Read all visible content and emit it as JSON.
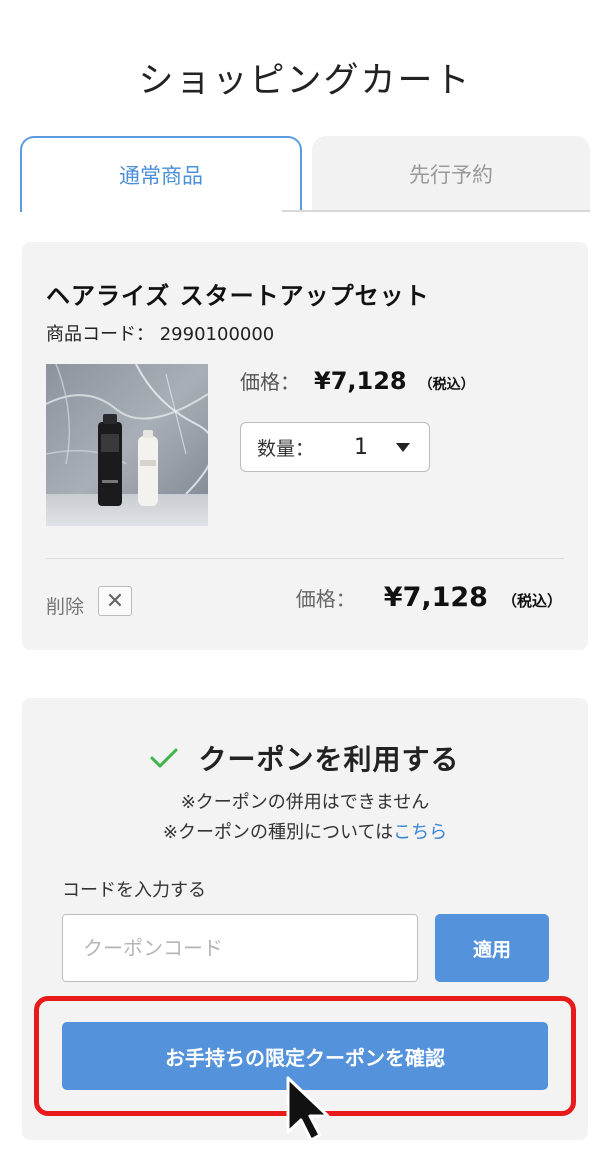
{
  "header": {
    "title": "ショッピングカート"
  },
  "tabs": [
    {
      "label": "通常商品",
      "active": true
    },
    {
      "label": "先行予約",
      "active": false
    }
  ],
  "cart_item": {
    "name": "ヘアライズ スタートアップセット",
    "code_label": "商品コード：",
    "code": "2990100000",
    "price_label": "価格：",
    "price": "¥7,128",
    "tax_label": "（税込）",
    "quantity_label": "数量：",
    "quantity": "1",
    "delete_label": "削除",
    "delete_icon": "close-icon",
    "total_label": "価格：",
    "total_price": "¥7,128",
    "total_tax_label": "（税込）"
  },
  "coupon": {
    "title": "クーポンを利用する",
    "check_icon": "check-icon",
    "note1": "※クーポンの併用はできません",
    "note2_prefix": "※クーポンの種別については",
    "note2_link": "こちら",
    "code_label": "コードを入力する",
    "input_placeholder": "クーポンコード",
    "input_value": "",
    "apply_label": "適用",
    "limited_button_label": "お手持ちの限定クーポンを確認"
  },
  "colors": {
    "accent": "#5592dc",
    "link": "#3b85d6",
    "tab_border": "#5d9be0",
    "check": "#3cb54a",
    "highlight": "#e81b1b",
    "card_bg": "#f3f3f3"
  }
}
